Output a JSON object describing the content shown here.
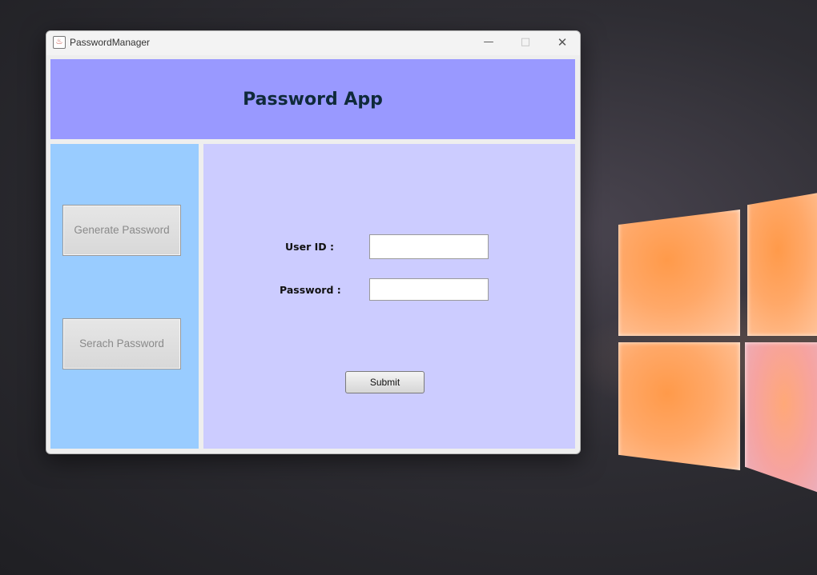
{
  "window": {
    "title": "PasswordManager",
    "minimize_glyph": "—",
    "maximize_glyph": "□",
    "close_glyph": "✕"
  },
  "header": {
    "title": "Password App",
    "background": "#9999ff"
  },
  "sidebar": {
    "background": "#99ccff",
    "buttons": [
      {
        "label": "Generate Password"
      },
      {
        "label": "Serach Password"
      }
    ]
  },
  "form": {
    "background": "#ccccff",
    "user_id_label": "User ID :",
    "user_id_value": "",
    "password_label": "Password :",
    "password_value": "",
    "submit_label": "Submit"
  },
  "icons": {
    "app": "java-cup-icon"
  }
}
